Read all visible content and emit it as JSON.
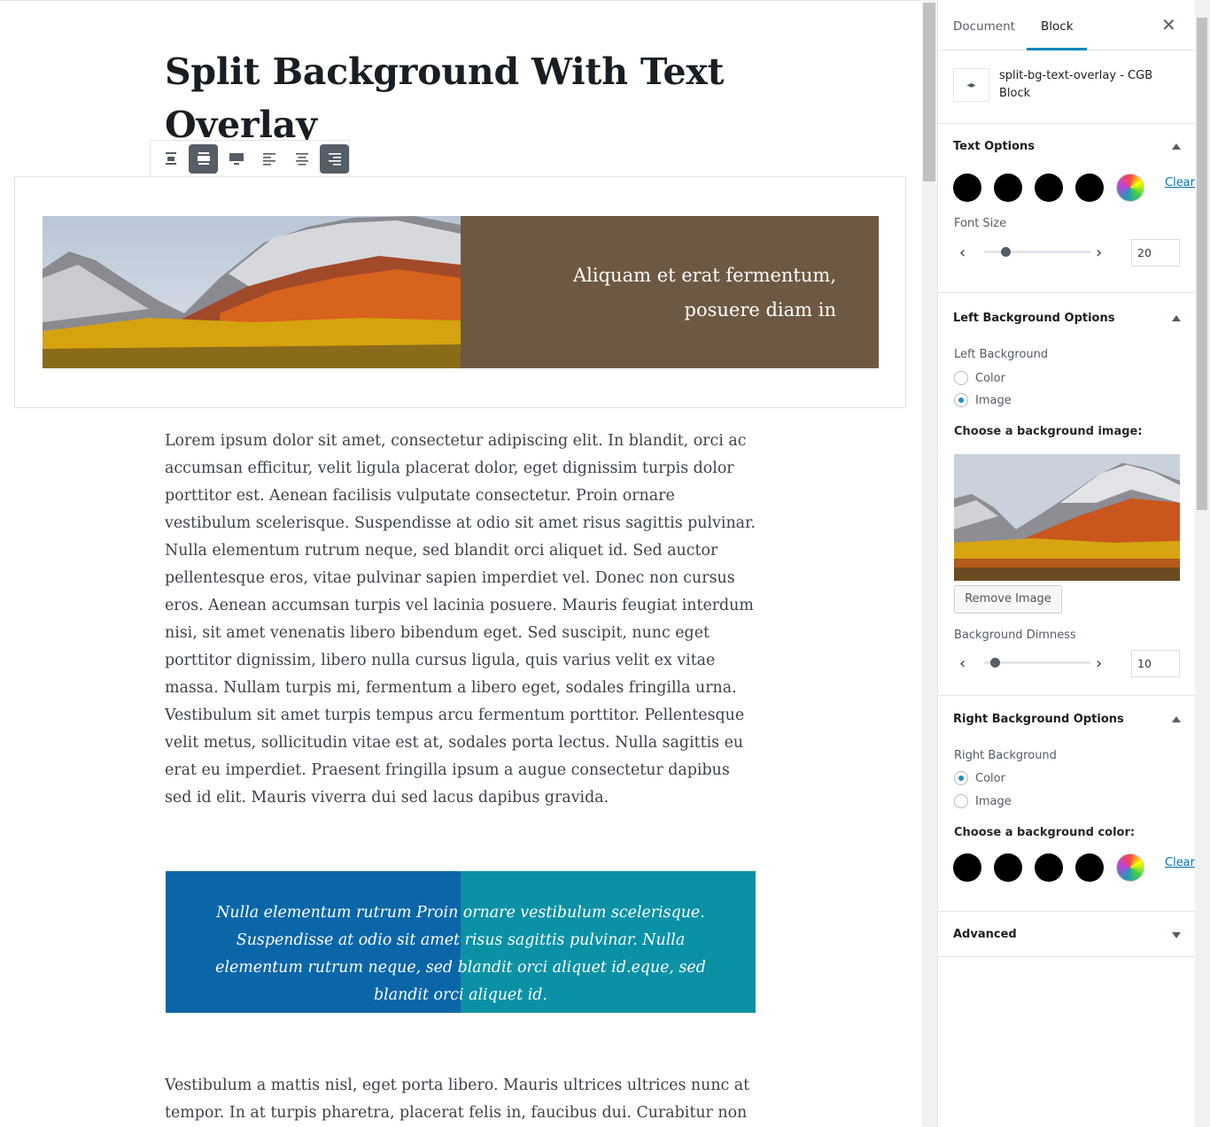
{
  "editor": {
    "post_title": "Split Background With Text Overlay",
    "split_block_text": "Aliquam et erat fermentum, posuere diam in",
    "paragraph_1": "Lorem ipsum dolor sit amet, consectetur adipiscing elit. In blandit, orci ac accumsan efficitur, velit ligula placerat dolor, eget dignissim turpis dolor porttitor est. Aenean facilisis vulputate consectetur. Proin ornare vestibulum scelerisque. Suspendisse at odio sit amet risus sagittis pulvinar. Nulla elementum rutrum neque, sed blandit orci aliquet id. Sed auctor pellentesque eros, vitae pulvinar sapien imperdiet vel. Donec non cursus eros. Aenean accumsan turpis vel lacinia posuere. Mauris feugiat interdum nisi, sit amet venenatis libero bibendum eget. Sed suscipit, nunc eget porttitor dignissim, libero nulla cursus ligula, quis varius velit ex vitae massa. Nullam turpis mi, fermentum a libero eget, sodales fringilla urna. Vestibulum sit amet turpis tempus arcu fermentum porttitor. Pellentesque velit metus, sollicitudin vitae est at, sodales porta lectus. Nulla sagittis eu erat eu imperdiet. Praesent fringilla ipsum a augue consectetur dapibus sed id elit. Mauris viverra dui sed lacus dapibus gravida.",
    "split_block_2_text": "Nulla elementum rutrum Proin ornare vestibulum scelerisque. Suspendisse at odio sit amet risus sagittis pulvinar. Nulla elementum rutrum neque, sed blandit orci aliquet id.eque, sed blandit orci aliquet id.",
    "paragraph_2": "Vestibulum a mattis nisl, eget porta libero. Mauris ultrices ultrices nunc at tempor. In at turpis pharetra, placerat felis in, faucibus dui. Curabitur non arcu",
    "colors": {
      "split_right": "#6d5843",
      "split2_left": "#0b66a8",
      "split2_right": "#0a91a5"
    },
    "toolbar_icons": [
      "align-center-icon",
      "align-wide-icon",
      "align-full-icon",
      "text-align-left-icon",
      "text-align-center-icon",
      "text-align-right-icon"
    ]
  },
  "sidebar": {
    "tabs": {
      "document": "Document",
      "block": "Block"
    },
    "close": "✕",
    "block_card": {
      "title": "split-bg-text-overlay - CGB Block",
      "icon": "◂▸"
    },
    "text_options": {
      "title": "Text Options",
      "clear": "Clear",
      "font_size_label": "Font Size",
      "font_size_value": "20",
      "font_size_range": {
        "min": 10,
        "max": 60,
        "value": 20
      }
    },
    "left_bg": {
      "title": "Left Background Options",
      "label": "Left Background",
      "option_color": "Color",
      "option_image": "Image",
      "selected": "Image",
      "choose_image": "Choose a background image:",
      "remove_image": "Remove Image",
      "dimness_label": "Background Dimness",
      "dimness_value": "10",
      "dimness_range": {
        "min": 0,
        "max": 100,
        "value": 10
      }
    },
    "right_bg": {
      "title": "Right Background Options",
      "label": "Right Background",
      "option_color": "Color",
      "option_image": "Image",
      "selected": "Color",
      "choose_color": "Choose a background color:",
      "clear": "Clear"
    },
    "advanced": {
      "title": "Advanced"
    },
    "accent": "#0085ba"
  }
}
